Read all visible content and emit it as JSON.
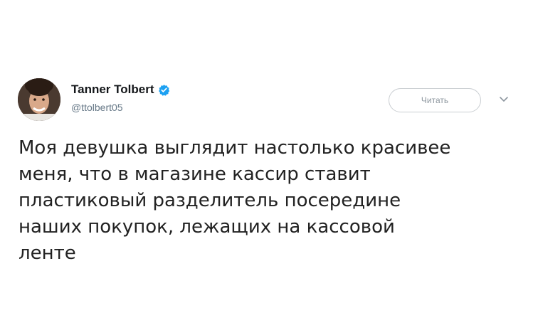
{
  "author": {
    "display_name": "Tanner Tolbert",
    "handle": "@ttolbert05",
    "verified": true
  },
  "actions": {
    "follow_label": "Читать",
    "menu_icon": "chevron-down-icon"
  },
  "tweet": {
    "text": "Моя девушка выглядит настолько красивее\nменя, что в магазине кассир ставит\nпластиковый разделитель посередине\nнаших покупок, лежащих на кассовой\nленте"
  },
  "colors": {
    "verified_badge": "#1da1f2",
    "handle": "#657786",
    "button_border": "#c9cdd1"
  }
}
